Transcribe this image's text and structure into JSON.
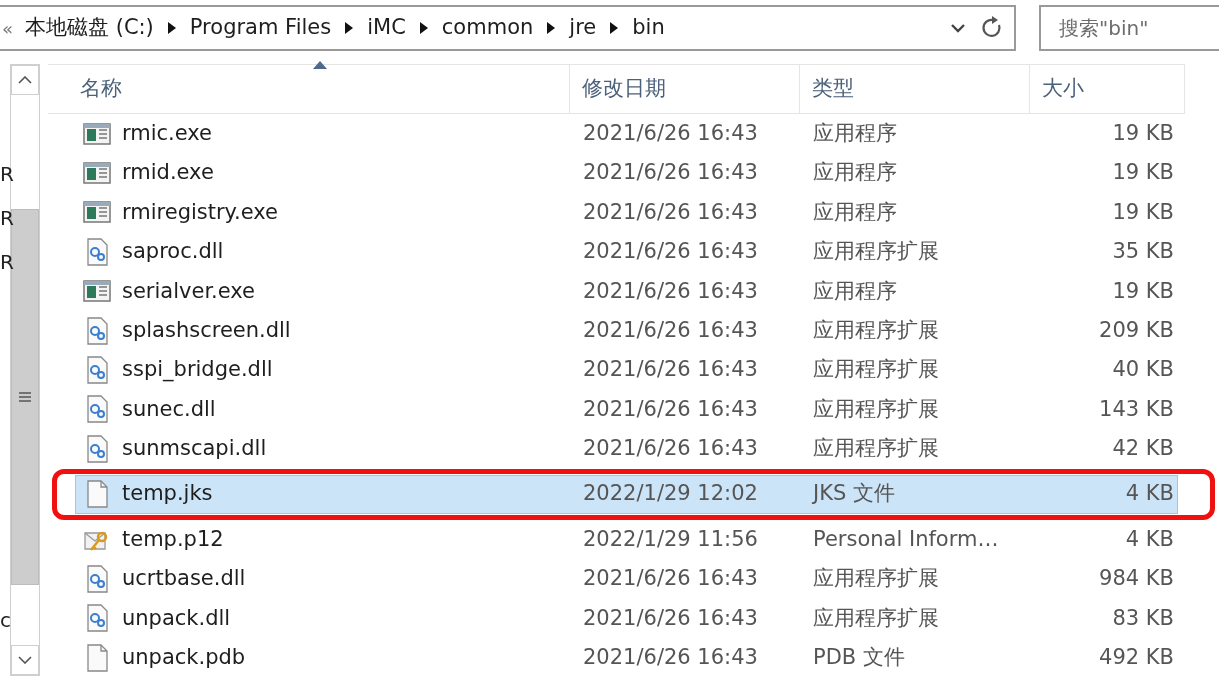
{
  "address_bar": {
    "overflow": "«",
    "crumbs": [
      "本地磁盘 (C:)",
      "Program Files",
      "iMC",
      "common",
      "jre",
      "bin"
    ]
  },
  "search": {
    "placeholder": "搜索\"bin\""
  },
  "navigation_pane": {
    "items": [
      "R",
      "R",
      "R",
      "c"
    ]
  },
  "table": {
    "columns": [
      {
        "label": "名称",
        "sorted": true
      },
      {
        "label": "修改日期",
        "sorted": false
      },
      {
        "label": "类型",
        "sorted": false
      },
      {
        "label": "大小",
        "sorted": false
      }
    ],
    "rows": [
      {
        "kind": "exe",
        "name": "rmic.exe",
        "date": "2021/6/26 16:43",
        "type": "应用程序",
        "size": "19 KB",
        "selected": false,
        "annotated": false
      },
      {
        "kind": "exe",
        "name": "rmid.exe",
        "date": "2021/6/26 16:43",
        "type": "应用程序",
        "size": "19 KB",
        "selected": false,
        "annotated": false
      },
      {
        "kind": "exe",
        "name": "rmiregistry.exe",
        "date": "2021/6/26 16:43",
        "type": "应用程序",
        "size": "19 KB",
        "selected": false,
        "annotated": false
      },
      {
        "kind": "dll",
        "name": "saproc.dll",
        "date": "2021/6/26 16:43",
        "type": "应用程序扩展",
        "size": "35 KB",
        "selected": false,
        "annotated": false
      },
      {
        "kind": "exe",
        "name": "serialver.exe",
        "date": "2021/6/26 16:43",
        "type": "应用程序",
        "size": "19 KB",
        "selected": false,
        "annotated": false
      },
      {
        "kind": "dll",
        "name": "splashscreen.dll",
        "date": "2021/6/26 16:43",
        "type": "应用程序扩展",
        "size": "209 KB",
        "selected": false,
        "annotated": false
      },
      {
        "kind": "dll",
        "name": "sspi_bridge.dll",
        "date": "2021/6/26 16:43",
        "type": "应用程序扩展",
        "size": "40 KB",
        "selected": false,
        "annotated": false
      },
      {
        "kind": "dll",
        "name": "sunec.dll",
        "date": "2021/6/26 16:43",
        "type": "应用程序扩展",
        "size": "143 KB",
        "selected": false,
        "annotated": false
      },
      {
        "kind": "dll",
        "name": "sunmscapi.dll",
        "date": "2021/6/26 16:43",
        "type": "应用程序扩展",
        "size": "42 KB",
        "selected": false,
        "annotated": false
      },
      {
        "kind": "file",
        "name": "temp.jks",
        "date": "2022/1/29 12:02",
        "type": "JKS 文件",
        "size": "4 KB",
        "selected": true,
        "annotated": true
      },
      {
        "kind": "cert",
        "name": "temp.p12",
        "date": "2022/1/29 11:56",
        "type": "Personal Inform…",
        "size": "4 KB",
        "selected": false,
        "annotated": false
      },
      {
        "kind": "dll",
        "name": "ucrtbase.dll",
        "date": "2021/6/26 16:43",
        "type": "应用程序扩展",
        "size": "984 KB",
        "selected": false,
        "annotated": false
      },
      {
        "kind": "dll",
        "name": "unpack.dll",
        "date": "2021/6/26 16:43",
        "type": "应用程序扩展",
        "size": "83 KB",
        "selected": false,
        "annotated": false
      },
      {
        "kind": "file",
        "name": "unpack.pdb",
        "date": "2021/6/26 16:43",
        "type": "PDB 文件",
        "size": "492 KB",
        "selected": false,
        "annotated": false
      }
    ]
  }
}
